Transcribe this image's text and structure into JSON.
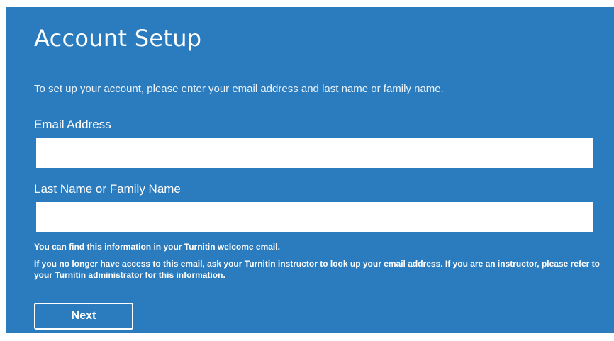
{
  "colors": {
    "panel_background": "#2b7cbf",
    "text": "#ffffff",
    "input_background": "#ffffff",
    "page_background": "#ffffff"
  },
  "form": {
    "title": "Account Setup",
    "intro": "To set up your account, please enter your email address and last name or family name.",
    "email": {
      "label": "Email Address",
      "value": "",
      "placeholder": ""
    },
    "last_name": {
      "label": "Last Name or Family Name",
      "value": "",
      "placeholder": ""
    },
    "note_welcome": "You can find this information in your Turnitin welcome email.",
    "note_access": "If you no longer have access to this email, ask your Turnitin instructor to look up your email address. If you are an instructor, please refer to your Turnitin administrator for this information.",
    "next_label": "Next"
  }
}
